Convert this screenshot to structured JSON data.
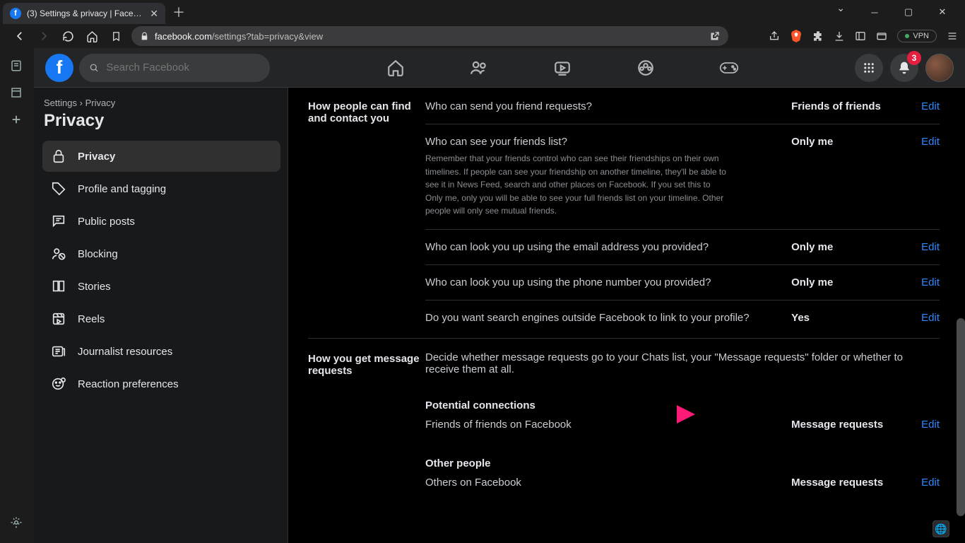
{
  "browser": {
    "tab_title": "(3) Settings & privacy | Facebook",
    "url_host": "facebook.com",
    "url_path": "/settings?tab=privacy&view",
    "vpn": "VPN"
  },
  "fb": {
    "search_placeholder": "Search Facebook",
    "notification_badge": "3"
  },
  "breadcrumb": {
    "root": "Settings",
    "sep": "›",
    "leaf": "Privacy"
  },
  "page_title": "Privacy",
  "sidebar": {
    "items": [
      {
        "label": "Privacy"
      },
      {
        "label": "Profile and tagging"
      },
      {
        "label": "Public posts"
      },
      {
        "label": "Blocking"
      },
      {
        "label": "Stories"
      },
      {
        "label": "Reels"
      },
      {
        "label": "Journalist resources"
      },
      {
        "label": "Reaction preferences"
      }
    ]
  },
  "section1": {
    "title": "How people can find and contact you",
    "rows": [
      {
        "q": "Who can send you friend requests?",
        "v": "Friends of friends",
        "edit": "Edit"
      },
      {
        "q": "Who can see your friends list?",
        "sub": "Remember that your friends control who can see their friendships on their own timelines. If people can see your friendship on another timeline, they'll be able to see it in News Feed, search and other places on Facebook. If you set this to Only me, only you will be able to see your full friends list on your timeline. Other people will only see mutual friends.",
        "v": "Only me",
        "edit": "Edit"
      },
      {
        "q": "Who can look you up using the email address you provided?",
        "v": "Only me",
        "edit": "Edit"
      },
      {
        "q": "Who can look you up using the phone number you provided?",
        "v": "Only me",
        "edit": "Edit"
      },
      {
        "q": "Do you want search engines outside Facebook to link to your profile?",
        "v": "Yes",
        "edit": "Edit"
      }
    ]
  },
  "section2": {
    "title": "How you get message requests",
    "intro": "Decide whether message requests go to your Chats list, your \"Message requests\" folder or whether to receive them at all.",
    "group1_title": "Potential connections",
    "group1_rows": [
      {
        "q": "Friends of friends on Facebook",
        "v": "Message requests",
        "edit": "Edit"
      }
    ],
    "group2_title": "Other people",
    "group2_rows": [
      {
        "q": "Others on Facebook",
        "v": "Message requests",
        "edit": "Edit"
      }
    ]
  }
}
